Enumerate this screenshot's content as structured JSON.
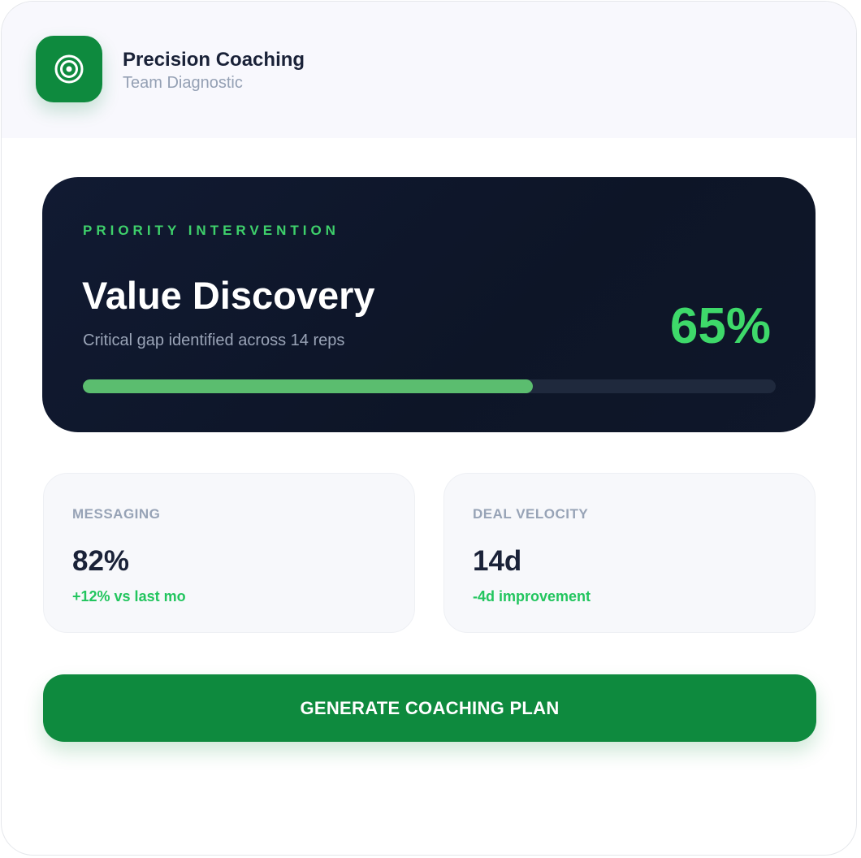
{
  "header": {
    "icon": "target-icon",
    "title": "Precision Coaching",
    "subtitle": "Team Diagnostic"
  },
  "hero": {
    "eyebrow": "PRIORITY INTERVENTION",
    "title": "Value Discovery",
    "subtitle": "Critical gap identified across 14 reps",
    "percent_label": "65%",
    "progress": 0.65
  },
  "stats": [
    {
      "label": "MESSAGING",
      "value": "82%",
      "delta": "+12% vs last mo"
    },
    {
      "label": "DEAL VELOCITY",
      "value": "14d",
      "delta": "-4d improvement"
    }
  ],
  "cta": {
    "label": "GENERATE COACHING PLAN"
  },
  "colors": {
    "brand": "#0e8a3e",
    "accent": "#3ed96a",
    "hero_bg": "#0f172a",
    "positive": "#22c55e"
  }
}
